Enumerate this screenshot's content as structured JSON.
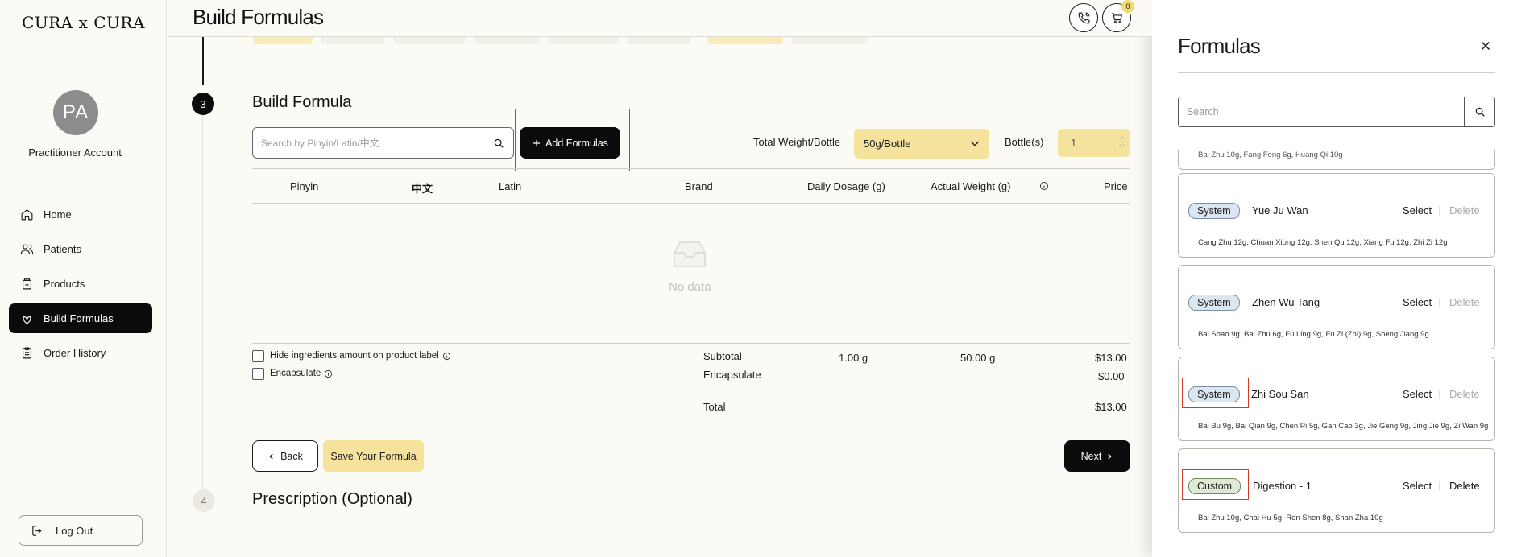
{
  "sidebar": {
    "logo": "CURA x CURA",
    "avatar_initials": "PA",
    "account_name": "Practitioner Account",
    "nav": [
      {
        "label": "Home",
        "icon": "home-icon"
      },
      {
        "label": "Patients",
        "icon": "users-icon"
      },
      {
        "label": "Products",
        "icon": "bottle-icon"
      },
      {
        "label": "Build Formulas",
        "icon": "herb-icon"
      },
      {
        "label": "Order History",
        "icon": "clipboard-icon"
      }
    ],
    "active_nav": "Build Formulas",
    "logout_label": "Log Out"
  },
  "header": {
    "title": "Build Formulas",
    "cart_count": "0"
  },
  "build": {
    "step_number": "3",
    "section_title": "Build Formula",
    "search_placeholder": "Search by Pinyin/Latin/中文",
    "add_label": "Add Formulas",
    "total_weight_label": "Total Weight/Bottle",
    "total_weight_value": "50g/Bottle",
    "bottles_label": "Bottle(s)",
    "bottles_value": "1",
    "columns": [
      "Pinyin",
      "中文",
      "Latin",
      "Brand",
      "Daily Dosage (g)",
      "Actual Weight (g)",
      "Price"
    ],
    "empty_text": "No data",
    "hide_label": "Hide ingredients amount on product label",
    "encapsulate_label": "Encapsulate",
    "subtotal_label": "Subtotal",
    "subtotal_dosage": "1.00 g",
    "subtotal_weight": "50.00 g",
    "subtotal_price": "$13.00",
    "encapsulate_row_label": "Encapsulate",
    "encapsulate_price": "$0.00",
    "total_label": "Total",
    "total_price": "$13.00",
    "back_label": "Back",
    "save_label": "Save Your Formula",
    "next_label": "Next",
    "next_step_number": "4",
    "next_step_title": "Prescription (Optional)"
  },
  "panel": {
    "title": "Formulas",
    "search_placeholder": "Search",
    "partial_ingredients": "Bai Zhu 10g, Fang Feng 6g, Huang Qi 10g",
    "items": [
      {
        "type": "System",
        "name": "Yue Ju Wan",
        "select": "Select",
        "delete": "Delete",
        "ingredients": "Cang Zhu 12g, Chuan Xiong 12g, Shen Qu 12g, Xiang Fu 12g, Zhi Zi 12g"
      },
      {
        "type": "System",
        "name": "Zhen Wu Tang",
        "select": "Select",
        "delete": "Delete",
        "ingredients": "Bai Shao 9g, Bai Zhu 6g, Fu Ling 9g, Fu Zi (Zhi) 9g, Sheng Jiang 9g"
      },
      {
        "type": "System",
        "name": "Zhi Sou San",
        "select": "Select",
        "delete": "Delete",
        "ingredients": "Bai Bu 9g, Bai Qian 9g, Chen Pi 5g, Gan Cao 3g, Jie Geng 9g, Jing Jie 9g, Zi Wan 9g"
      },
      {
        "type": "Custom",
        "name": "Digestion - 1",
        "select": "Select",
        "delete": "Delete",
        "ingredients": "Bai Zhu 10g, Chai Hu 5g, Ren Shen 8g, Shan Zha 10g"
      }
    ]
  },
  "colors": {
    "accent_yellow": "#f5e29c",
    "dark": "#0b0b0b",
    "highlight_red": "#d03a2a",
    "system_badge": "#dce6f0",
    "custom_badge": "#dfead6"
  }
}
